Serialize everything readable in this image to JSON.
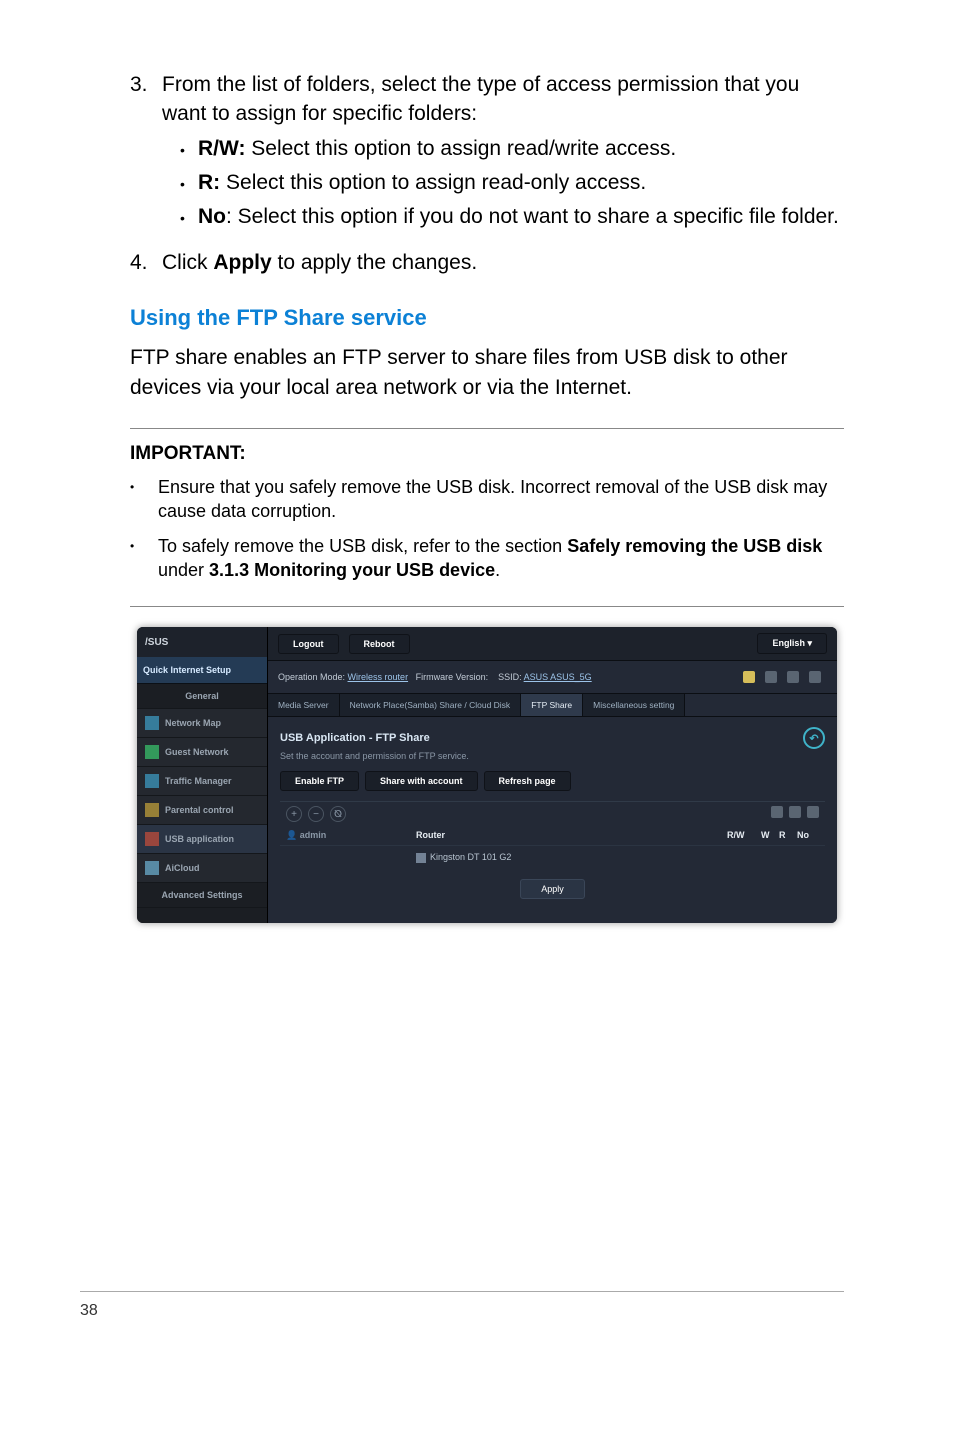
{
  "step3": {
    "num": "3.",
    "text": "From the list of folders, select the type of access permission that you want to assign for specific folders:",
    "rw_label": "R/W:",
    "rw_text": "  Select this option to assign read/write access.",
    "r_label": "R:",
    "r_text": "  Select this option to assign read-only access.",
    "no_label": "No",
    "no_text": ":  Select this option if you do not want to share a specific file folder."
  },
  "step4": {
    "num": "4.",
    "pre": "Click ",
    "bold": "Apply",
    "post": " to apply the changes."
  },
  "ftp_heading": "Using the FTP Share service",
  "ftp_para": "FTP share enables an FTP server to share files from USB disk to other devices via your local area network or via the Internet.",
  "important": {
    "label": "IMPORTANT",
    "colon": ":",
    "item1": "Ensure that you safely remove the USB disk. Incorrect removal of the USB disk may cause data corruption.",
    "item2_pre": "To safely remove the USB disk, refer to the section ",
    "item2_bold1": "Safely removing the USB disk",
    "item2_mid": " under ",
    "item2_bold2": "3.1.3 Monitoring your USB device",
    "item2_post": "."
  },
  "page_num": "38",
  "mock": {
    "logout": "Logout",
    "reboot": "Reboot",
    "english": "English",
    "side_setup": "Quick Internet Setup",
    "side_general": "General",
    "side_map": "Network Map",
    "side_guest": "Guest Network",
    "side_traffic": "Traffic Manager",
    "side_parent": "Parental control",
    "side_usb": "USB application",
    "side_cloud": "AiCloud",
    "side_adv": "Advanced Settings",
    "opmode_pre": "Operation Mode: ",
    "opmode": "Wireless router",
    "fwv": "Firmware Version:",
    "ssid_pre": "SSID: ",
    "ssid": "ASUS  ASUS_5G",
    "tab_media": "Media Server",
    "tab_samba": "Network Place(Samba) Share / Cloud Disk",
    "tab_ftp": "FTP Share",
    "tab_misc": "Miscellaneous setting",
    "panel_title": "USB Application - FTP Share",
    "panel_sub": "Set the account and permission of FTP service.",
    "enable": "Enable FTP",
    "sharewith": "Share with account",
    "refresh": "Refresh page",
    "col_user": "admin",
    "col_router": "Router",
    "col_device": "Kingston DT 101 G2",
    "col_rw": "R/W",
    "col_w": "W",
    "col_r": "R",
    "col_no": "No",
    "apply": "Apply"
  }
}
